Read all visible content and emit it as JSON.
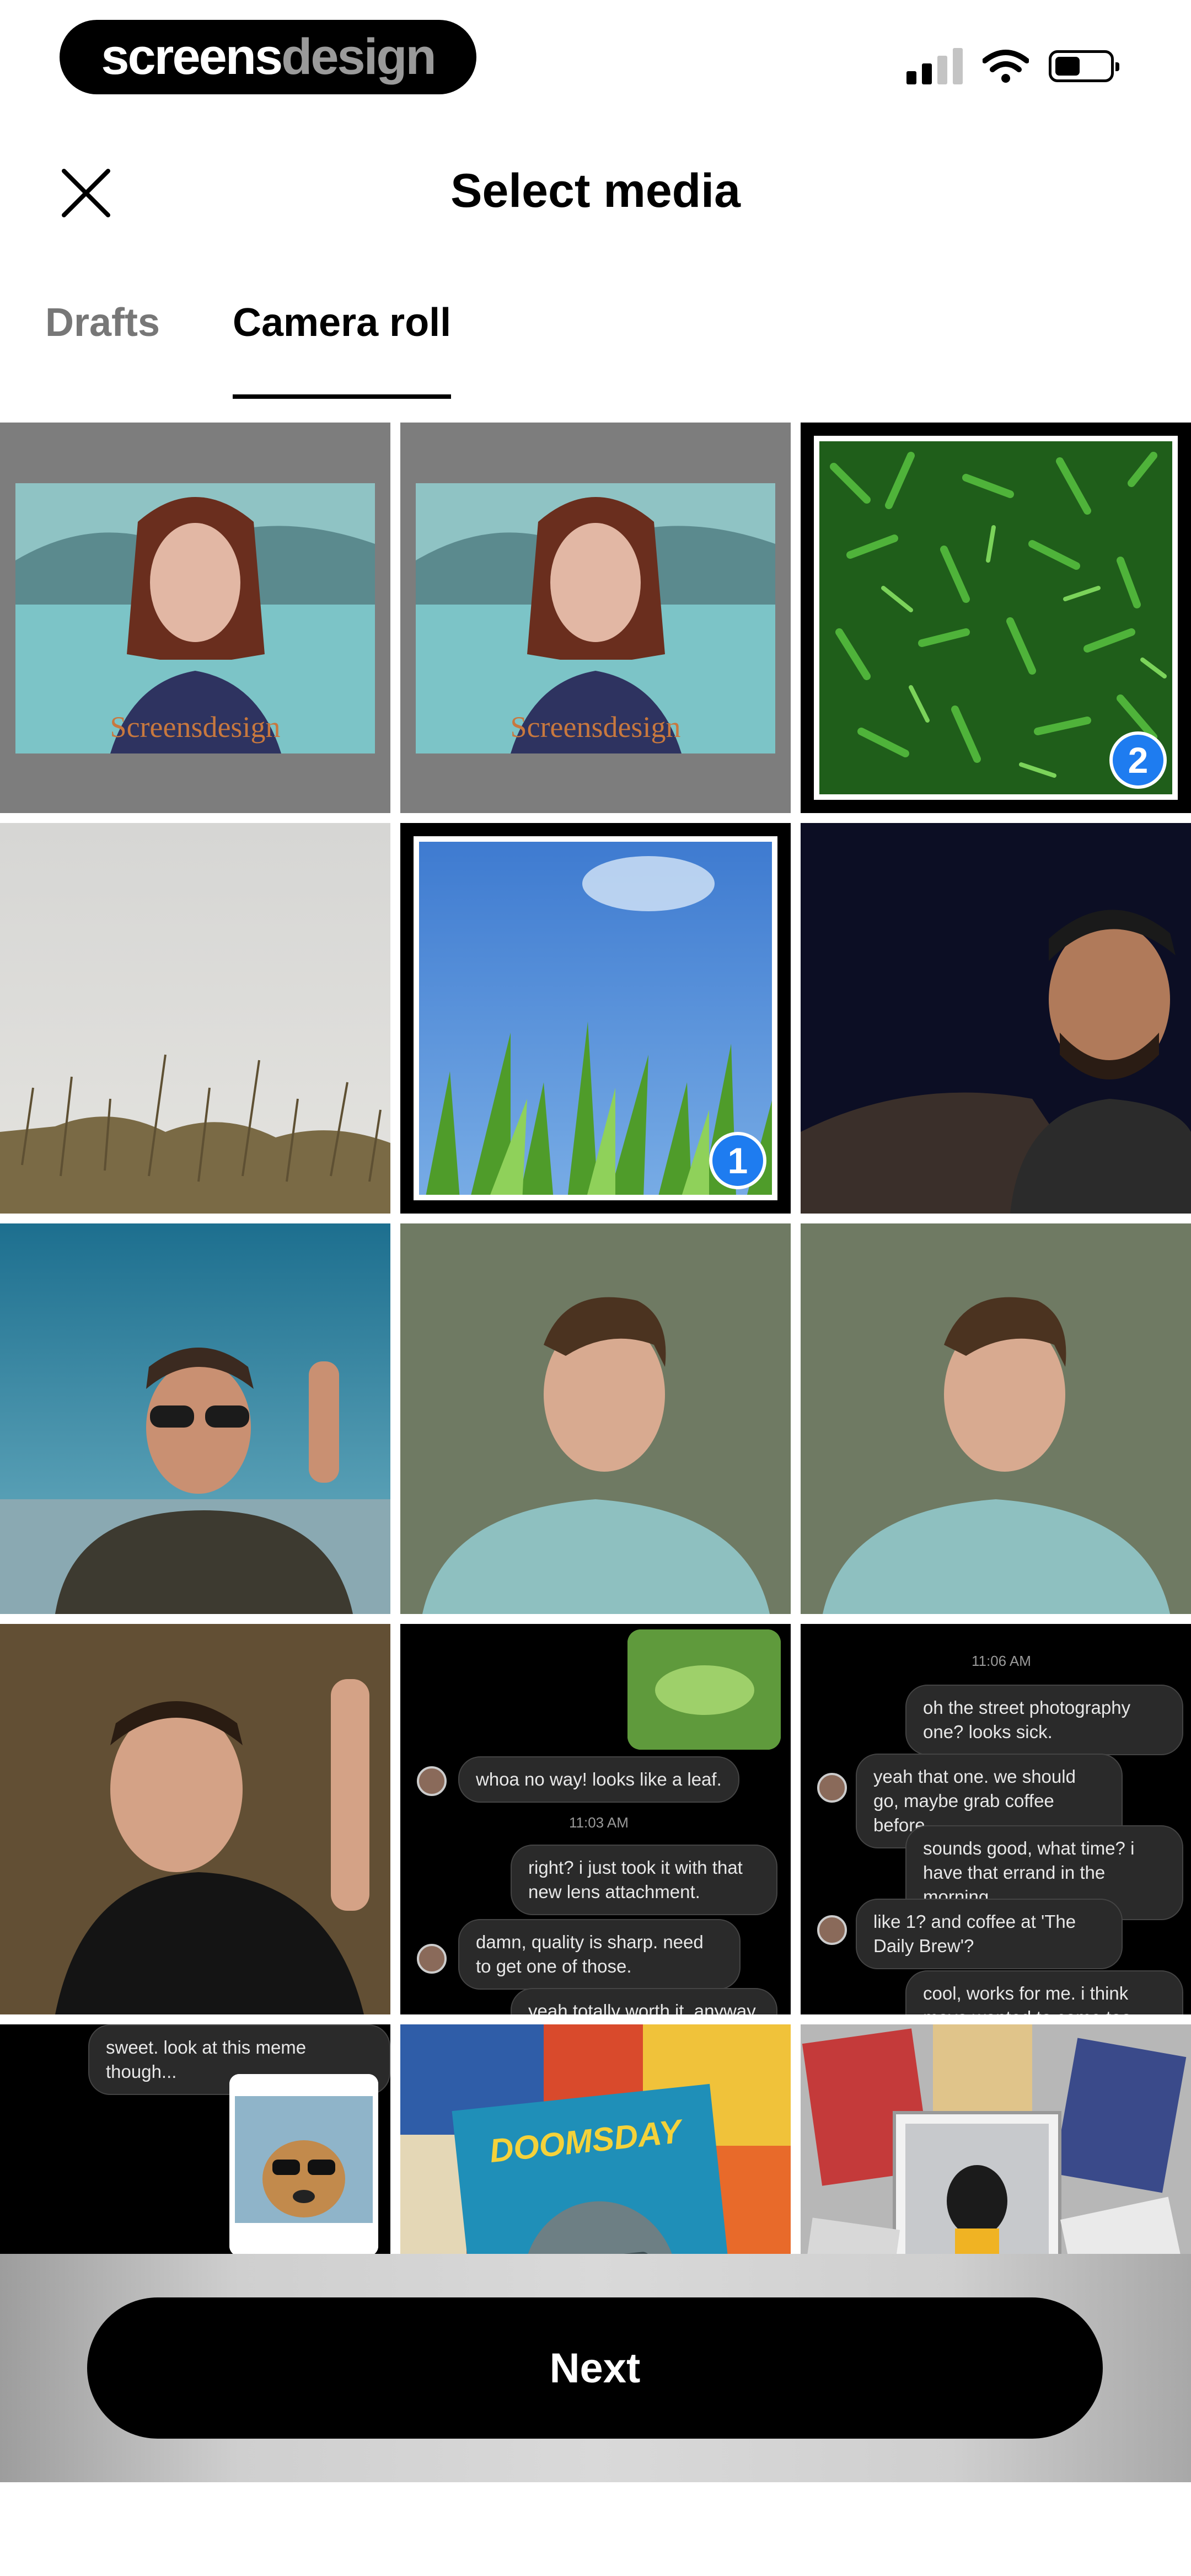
{
  "status_bar": {
    "brand_part1": "screens",
    "brand_part2": "design"
  },
  "header": {
    "title": "Select media"
  },
  "tabs": [
    {
      "label": "Drafts",
      "active": false
    },
    {
      "label": "Camera roll",
      "active": true
    }
  ],
  "media": [
    {
      "kind": "portrait-woman",
      "watermark": "Screensdesign",
      "selected": false
    },
    {
      "kind": "portrait-woman",
      "watermark": "Screensdesign",
      "selected": false
    },
    {
      "kind": "grass-closeup",
      "selected": true,
      "order": "2"
    },
    {
      "kind": "foggy-field",
      "selected": false
    },
    {
      "kind": "grass-sky",
      "selected": true,
      "order": "1"
    },
    {
      "kind": "man-smiling-dark",
      "selected": false
    },
    {
      "kind": "man-sunglasses-selfie",
      "selected": false
    },
    {
      "kind": "man-portrait-wall",
      "selected": false
    },
    {
      "kind": "man-portrait-wall",
      "selected": false
    },
    {
      "kind": "man-selfie-forest",
      "selected": false
    },
    {
      "kind": "chat-screenshot",
      "selected": false
    },
    {
      "kind": "chat-screenshot",
      "selected": false
    },
    {
      "kind": "chat-meme-screenshot",
      "selected": false
    },
    {
      "kind": "comic-books",
      "selected": false
    },
    {
      "kind": "hockey-cards",
      "selected": false
    }
  ],
  "chat1": {
    "msg1": "whoa no way! looks like a leaf.",
    "time": "11:03 AM",
    "msg2": "right? i just took it with that new lens attachment.",
    "msg3": "damn, quality is sharp. need to get one of those.",
    "msg4": "yeah totally worth it. anyway"
  },
  "chat2": {
    "time": "11:06 AM",
    "msg1": "oh the street photography one? looks sick.",
    "msg2": "yeah that one. we should go, maybe grab coffee before.",
    "msg3": "sounds good, what time? i have that errand in the morning.",
    "msg4": "like 1? and coffee at 'The Daily Brew'?",
    "msg5": "cool, works for me. i think maya wanted to come too"
  },
  "chat3": {
    "msg1": "sweet. look at this meme though..."
  },
  "comic": {
    "title": "DOOMSDAY"
  },
  "footer": {
    "next_label": "Next"
  },
  "colors": {
    "accent_badge": "#1e7cf0",
    "button": "#000000"
  }
}
